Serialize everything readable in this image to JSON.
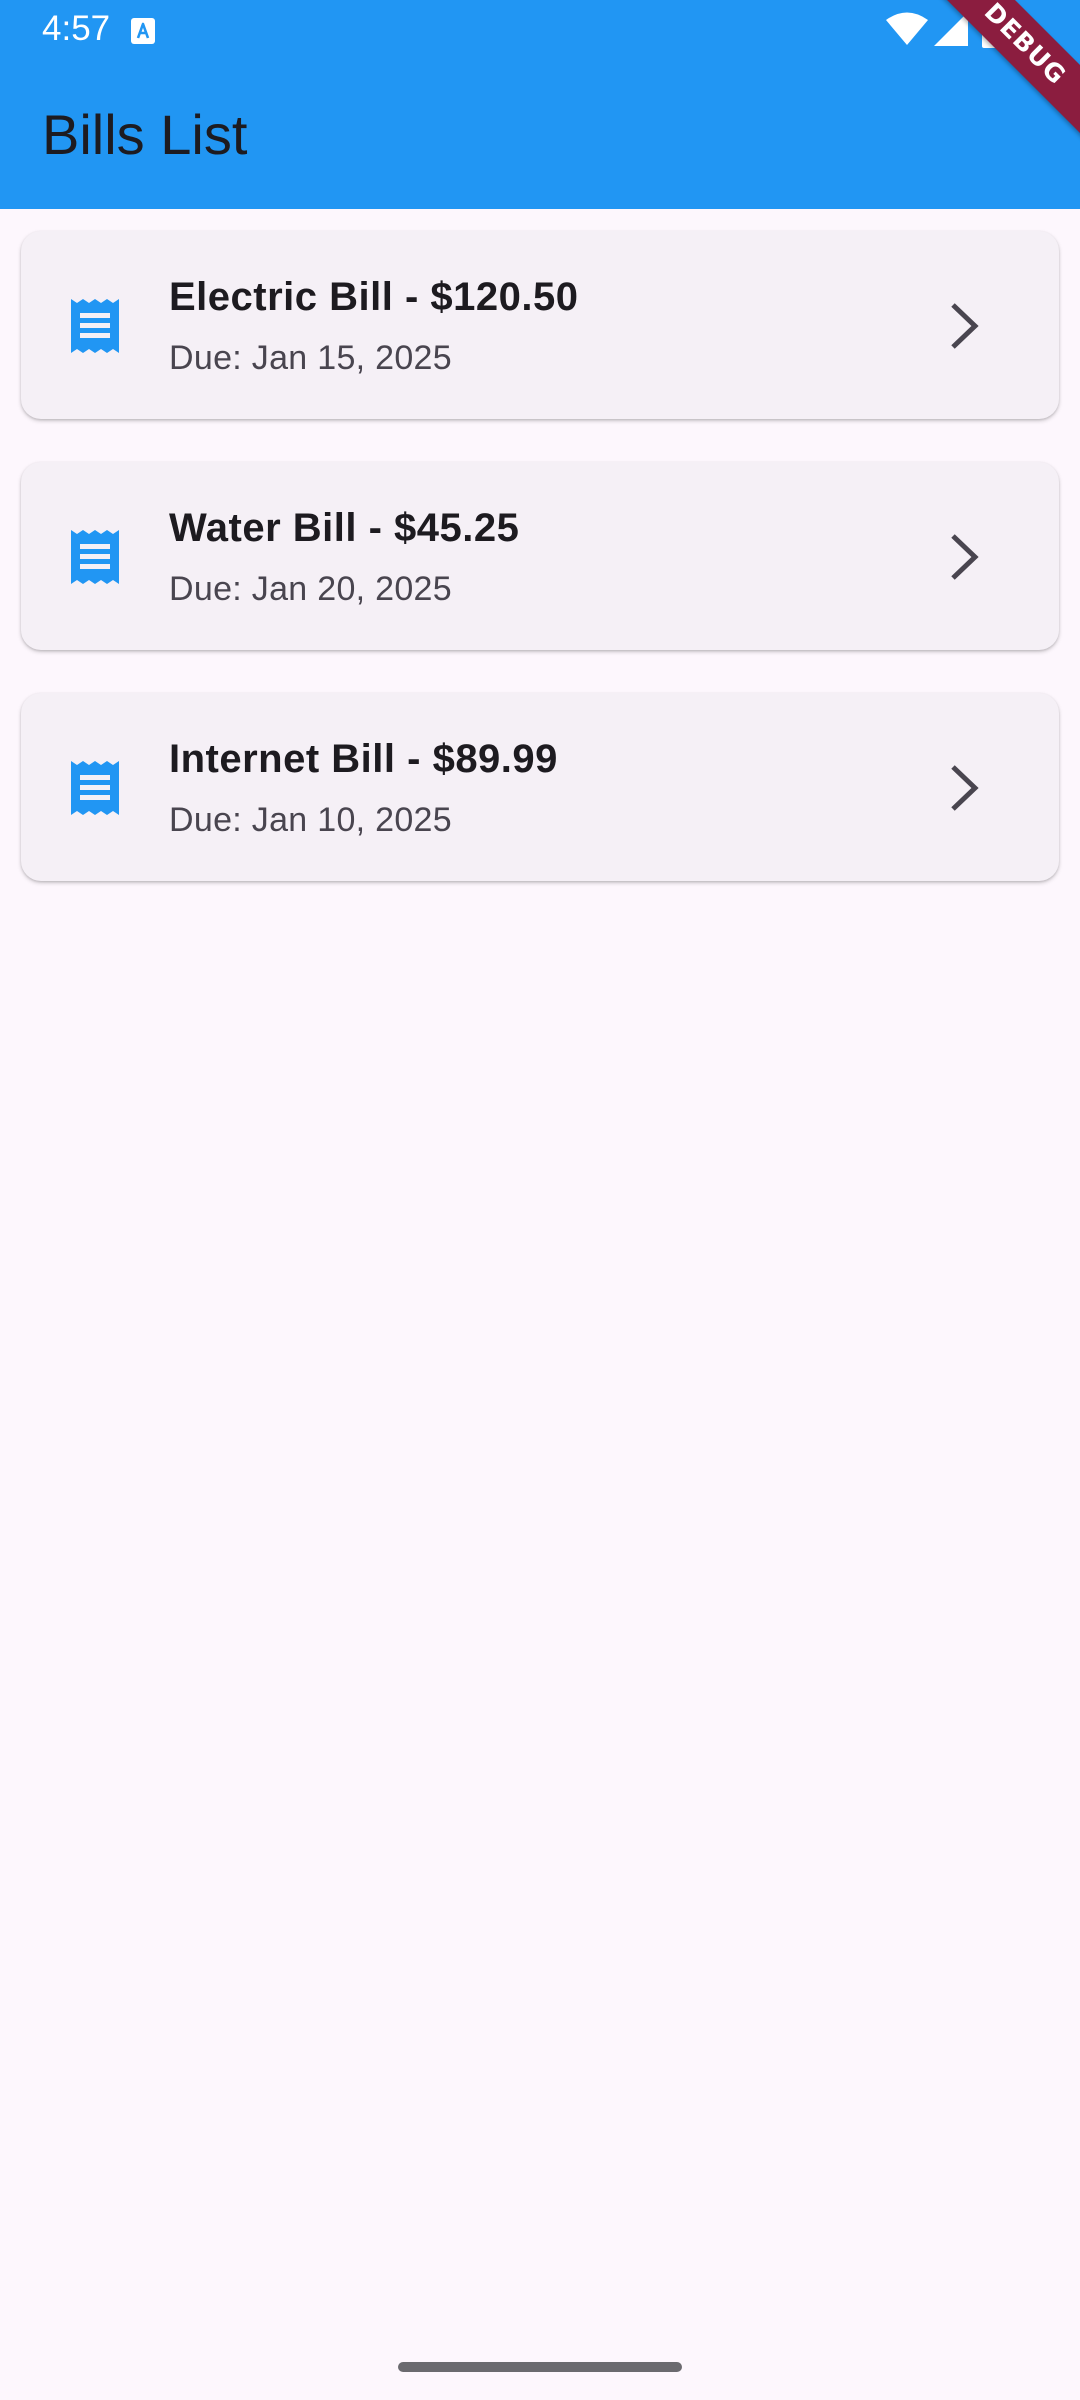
{
  "status_bar": {
    "time": "4:57"
  },
  "debug_banner": "DEBUG",
  "app_bar": {
    "title": "Bills List"
  },
  "bills": [
    {
      "title": "Electric Bill - $120.50",
      "due": "Due: Jan 15, 2025",
      "icon": "receipt-icon"
    },
    {
      "title": "Water Bill - $45.25",
      "due": "Due: Jan 20, 2025",
      "icon": "receipt-icon"
    },
    {
      "title": "Internet Bill - $89.99",
      "due": "Due: Jan 10, 2025",
      "icon": "receipt-icon"
    }
  ],
  "colors": {
    "app_bar": "#2196F3",
    "background": "#FDF7FD",
    "card": "#F5F0F6",
    "icon_accent": "#2196F3",
    "debug_banner": "#8B1D3F"
  }
}
